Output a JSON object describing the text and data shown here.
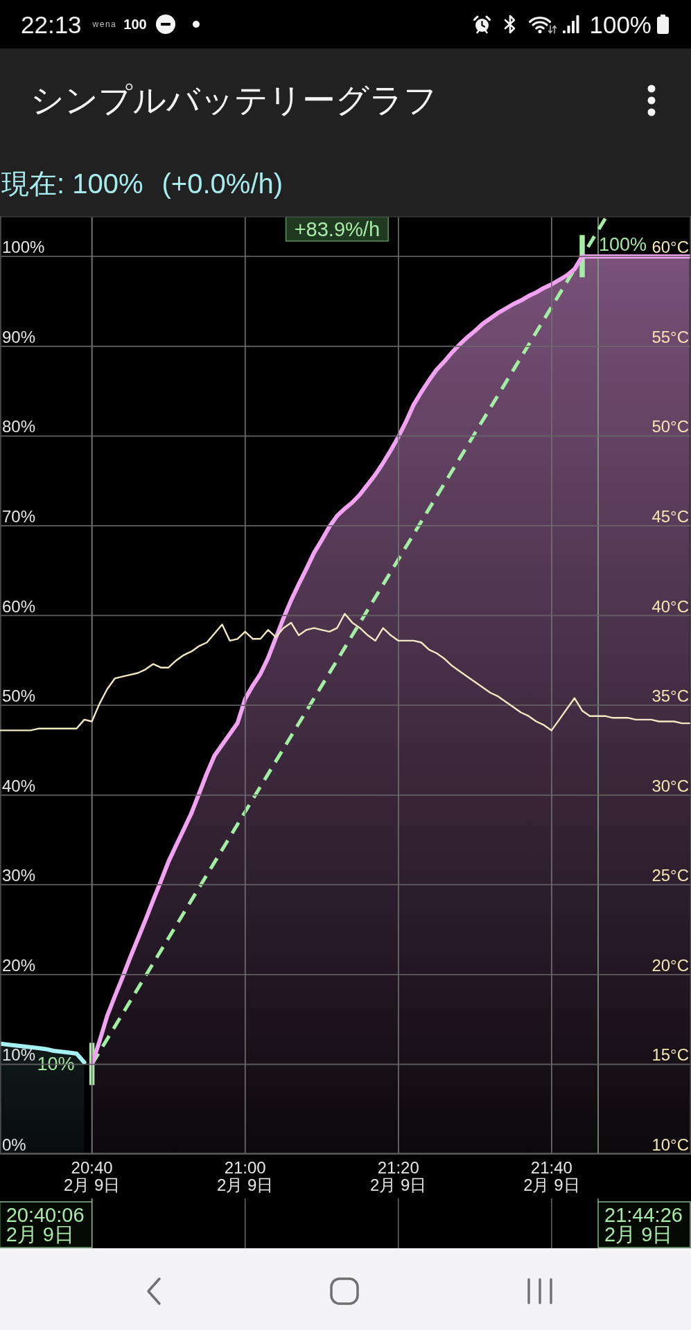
{
  "status_bar": {
    "time": "22:13",
    "app_label": "wena",
    "app_count": "100",
    "battery": "100%"
  },
  "app_bar": {
    "title": "シンプルバッテリーグラフ"
  },
  "summary": {
    "current": "現在: 100%",
    "rate": "(+0.0%/h)"
  },
  "battery_chart": {
    "chart_data": {
      "type": "area",
      "grid": true,
      "ylim": [
        0,
        104.5
      ],
      "yticks": [
        {
          "value": 0,
          "label": "0%"
        },
        {
          "value": 10,
          "label": "10%"
        },
        {
          "value": 20,
          "label": "20%"
        },
        {
          "value": 30,
          "label": "30%"
        },
        {
          "value": 40,
          "label": "40%"
        },
        {
          "value": 50,
          "label": "50%"
        },
        {
          "value": 60,
          "label": "60%"
        },
        {
          "value": 70,
          "label": "70%"
        },
        {
          "value": 80,
          "label": "80%"
        },
        {
          "value": 90,
          "label": "90%"
        },
        {
          "value": 100,
          "label": "100%"
        }
      ],
      "categories": [
        null,
        null,
        null,
        null,
        null,
        null,
        null,
        null,
        null,
        null,
        null,
        null,
        "20:40\n2月 9日",
        null,
        null,
        null,
        null,
        null,
        null,
        null,
        null,
        null,
        null,
        null,
        null,
        null,
        null,
        null,
        null,
        null,
        null,
        null,
        "21:00\n2月 9日",
        null,
        null,
        null,
        null,
        null,
        null,
        null,
        null,
        null,
        null,
        null,
        null,
        null,
        null,
        null,
        null,
        null,
        null,
        null,
        "21:20\n2月 9日",
        null,
        null,
        null,
        null,
        null,
        null,
        null,
        null,
        null,
        null,
        null,
        null,
        null,
        null,
        null,
        null,
        null,
        null,
        null,
        "21:40\n2月 9日",
        null,
        null,
        null,
        null,
        null,
        null,
        null,
        null,
        null,
        null,
        null,
        null,
        null,
        null,
        null,
        null,
        null,
        null
      ],
      "series": [
        {
          "color": "#a6f2f2",
          "values": [
            12.3,
            12.2,
            12.1,
            12,
            11.9,
            11.8,
            11.7,
            11.5,
            11.4,
            11.3,
            11.2,
            10.2,
            null,
            null,
            null,
            null,
            null,
            null,
            null,
            null,
            null,
            null,
            null,
            null,
            null,
            null,
            null,
            null,
            null,
            null,
            null,
            null,
            null,
            null,
            null,
            null,
            null,
            null,
            null,
            null,
            null,
            null,
            null,
            null,
            null,
            null,
            null,
            null,
            null,
            null,
            null,
            null,
            null,
            null,
            null,
            null,
            null,
            null,
            null,
            null,
            null,
            null,
            null,
            null,
            null,
            null,
            null,
            null,
            null,
            null,
            null,
            null,
            null,
            null,
            null,
            null,
            null,
            null,
            null,
            null,
            null,
            null,
            null,
            null,
            null,
            null,
            null,
            null,
            null,
            null,
            null
          ]
        },
        {
          "color": "#f2a2f2",
          "values": [
            null,
            null,
            null,
            null,
            null,
            null,
            null,
            null,
            null,
            null,
            null,
            null,
            10,
            12.6,
            15.4,
            17.6,
            19.7,
            21.9,
            24,
            26.1,
            28.3,
            30.4,
            32.6,
            34.4,
            36.2,
            38,
            40.2,
            42.4,
            44.4,
            45.6,
            46.8,
            48,
            50.7,
            52.2,
            53.5,
            55.3,
            57.5,
            59.7,
            61.7,
            63.5,
            65.2,
            67,
            68.4,
            69.9,
            71.1,
            71.9,
            72.6,
            73.5,
            74.6,
            75.7,
            77,
            78.4,
            79.9,
            81.6,
            83.5,
            84.9,
            86.2,
            87.4,
            88.3,
            89.3,
            90.2,
            91,
            91.7,
            92.5,
            93.1,
            93.7,
            94.2,
            94.7,
            95.1,
            95.6,
            96,
            96.5,
            96.9,
            97.4,
            97.9,
            98.6,
            100,
            100,
            100,
            100,
            100,
            100,
            100,
            100,
            100,
            100,
            100,
            100,
            100,
            100,
            100
          ]
        }
      ]
    },
    "trend": {
      "rate": "+83.9%/h"
    },
    "markers": [
      {
        "label": "10%",
        "time": "20:40:06",
        "date": "2月 9日"
      },
      {
        "label": "100%",
        "time": "21:44:26",
        "date": "2月 9日"
      }
    ]
  },
  "temperature_chart": {
    "chart_data": {
      "type": "line",
      "grid": true,
      "ylim": [
        10,
        62.25
      ],
      "yticks": [
        {
          "value": 10,
          "label": "10°C"
        },
        {
          "value": 15,
          "label": "15°C"
        },
        {
          "value": 20,
          "label": "20°C"
        },
        {
          "value": 25,
          "label": "25°C"
        },
        {
          "value": 30,
          "label": "30°C"
        },
        {
          "value": 35,
          "label": "35°C"
        },
        {
          "value": 40,
          "label": "40°C"
        },
        {
          "value": 45,
          "label": "45°C"
        },
        {
          "value": 50,
          "label": "50°C"
        },
        {
          "value": 55,
          "label": "55°C"
        },
        {
          "value": 60,
          "label": "60°C"
        }
      ],
      "categories": [
        null,
        null,
        null,
        null,
        null,
        null,
        null,
        null,
        null,
        null,
        null,
        null,
        null,
        null,
        null,
        null,
        null,
        null,
        null,
        null,
        null,
        null,
        null,
        null,
        null,
        null,
        null,
        null,
        null,
        null,
        null,
        null,
        null,
        null,
        null,
        null,
        null,
        null,
        null,
        null,
        null,
        null,
        null,
        null,
        null,
        null,
        null,
        null,
        null,
        null,
        null,
        null,
        null,
        null,
        null,
        null,
        null,
        null,
        null,
        null,
        null,
        null,
        null,
        null,
        null,
        null,
        null,
        null,
        null,
        null,
        null,
        null,
        null,
        null,
        null,
        null,
        null,
        null,
        null,
        null,
        null,
        null,
        null,
        null,
        null,
        null,
        null,
        null,
        null,
        null,
        null
      ],
      "series": [
        {
          "color": "#f2e8c2",
          "values": [
            33.6,
            33.6,
            33.6,
            33.6,
            33.6,
            33.7,
            33.7,
            33.7,
            33.7,
            33.7,
            33.7,
            34.2,
            34.1,
            35.1,
            35.9,
            36.5,
            36.6,
            36.7,
            36.8,
            37,
            37.3,
            37.1,
            37.1,
            37.5,
            37.8,
            38,
            38.3,
            38.5,
            39,
            39.5,
            38.6,
            38.7,
            39.1,
            38.7,
            38.7,
            39.2,
            38.8,
            39.3,
            39.6,
            38.9,
            39.2,
            39.3,
            39.2,
            39.1,
            39.3,
            40.1,
            39.6,
            39.3,
            38.9,
            38.6,
            39.3,
            38.9,
            38.6,
            38.6,
            38.6,
            38.5,
            38.1,
            37.9,
            37.6,
            37.2,
            36.9,
            36.6,
            36.3,
            36,
            35.7,
            35.5,
            35.2,
            34.9,
            34.6,
            34.4,
            34.1,
            33.9,
            33.6,
            34.2,
            34.8,
            35.4,
            34.7,
            34.4,
            34.4,
            34.4,
            34.3,
            34.3,
            34.3,
            34.2,
            34.2,
            34.2,
            34.1,
            34.1,
            34.1,
            34,
            34
          ]
        }
      ]
    }
  }
}
